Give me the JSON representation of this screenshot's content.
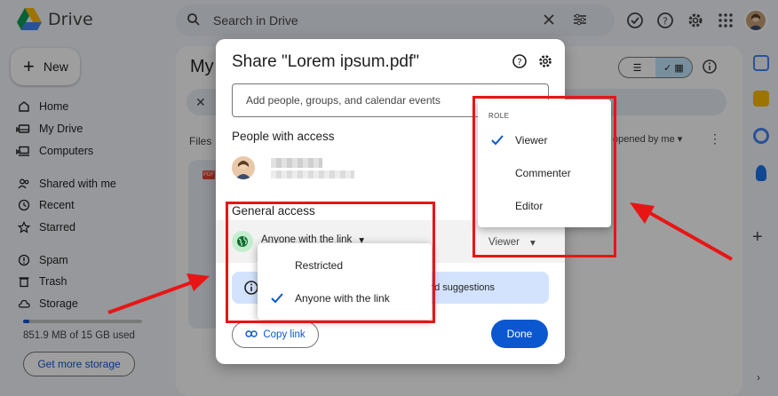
{
  "app": {
    "name": "Drive",
    "search_placeholder": "Search in Drive",
    "new_label": "New"
  },
  "sidebar": {
    "items": [
      {
        "label": "Home",
        "icon": "home-icon"
      },
      {
        "label": "My Drive",
        "icon": "drive-icon"
      },
      {
        "label": "Computers",
        "icon": "computer-icon"
      },
      {
        "label": "Shared with me",
        "icon": "people-icon"
      },
      {
        "label": "Recent",
        "icon": "clock-icon"
      },
      {
        "label": "Starred",
        "icon": "star-icon"
      },
      {
        "label": "Spam",
        "icon": "spam-icon"
      },
      {
        "label": "Trash",
        "icon": "trash-icon"
      },
      {
        "label": "Storage",
        "icon": "cloud-icon"
      }
    ],
    "storage_used_fraction": 0.05,
    "storage_text": "851.9 MB of 15 GB used",
    "get_storage_label": "Get more storage"
  },
  "main": {
    "title_partial": "My",
    "files_label": "Files",
    "sort_label": "opened by me",
    "file_badge": "PDF"
  },
  "dialog": {
    "title": "Share \"Lorem ipsum.pdf\"",
    "add_placeholder": "Add people, groups, and calendar events",
    "people_heading": "People with access",
    "general_heading": "General access",
    "general_value": "Anyone with the link",
    "role_value": "Viewer",
    "info_text": "nd suggestions",
    "copy_link_label": "Copy link",
    "done_label": "Done"
  },
  "access_menu": {
    "items": [
      {
        "label": "Restricted",
        "selected": false
      },
      {
        "label": "Anyone with the link",
        "selected": true
      }
    ]
  },
  "role_menu": {
    "header": "ROLE",
    "items": [
      {
        "label": "Viewer",
        "selected": true
      },
      {
        "label": "Commenter",
        "selected": false
      },
      {
        "label": "Editor",
        "selected": false
      }
    ]
  },
  "colors": {
    "accent_blue": "#0b57d0",
    "annotation_red": "#e81515",
    "selected_chip": "#c2e7ff"
  }
}
